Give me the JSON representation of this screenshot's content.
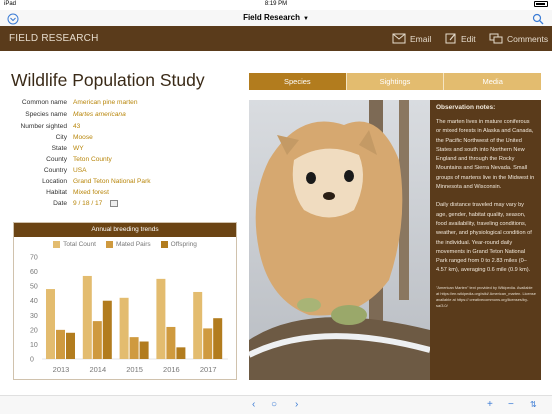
{
  "status_bar": {
    "device": "iPad",
    "time": "8:19 PM",
    "battery_percent": 100,
    "battery_label": ""
  },
  "nav_bar": {
    "title": "Field Research",
    "colors": {
      "tint": "#3a7bd5"
    }
  },
  "toolbar": {
    "brand": "FIELD RESEARCH",
    "email_label": "Email",
    "edit_label": "Edit",
    "comments_label": "Comments",
    "colors": {
      "background": "#5a3b1b",
      "text": "#e6dccd"
    }
  },
  "record": {
    "title": "Wildlife Population Study",
    "fields": [
      {
        "label": "Common name",
        "value": "American pine marten"
      },
      {
        "label": "Species name",
        "value": "Martes americana"
      },
      {
        "label": "Number sighted",
        "value": "43"
      },
      {
        "label": "City",
        "value": "Moose"
      },
      {
        "label": "State",
        "value": "WY"
      },
      {
        "label": "County",
        "value": "Teton County"
      },
      {
        "label": "Country",
        "value": "USA"
      },
      {
        "label": "Location",
        "value": "Grand Teton National Park"
      },
      {
        "label": "Habitat",
        "value": "Mixed forest"
      },
      {
        "label": "Date",
        "value": "9 / 18 / 17"
      }
    ],
    "colors": {
      "value": "#b8860b"
    }
  },
  "tabs": [
    {
      "label": "Species",
      "active": true
    },
    {
      "label": "Sightings",
      "active": false
    },
    {
      "label": "Media",
      "active": false
    }
  ],
  "notes": {
    "heading": "Observation notes:",
    "paragraph1": "The marten lives in mature coniferous or mixed forests in Alaska and Canada, the Pacific Northwest of the United States and south into Northern New England and through the Rocky Mountains and Sierra Nevada. Small groups of martens live in the Midwest in Minnesota and Wisconsin.",
    "paragraph2": "Daily distance traveled may vary by age, gender, habitat quality, season, food availability, traveling conditions, weather, and physiological condition of the individual. Year-round daily movements in Grand Teton National Park ranged from 0 to 2.83 miles (0–4.57 km), averaging 0.6 mile (0.9 km).",
    "credit": "\"American Marten\" text provided by Wikipedia. Available at https://en.wikipedia.org/wiki/ American_marten. License available at https:// creativecommons.org/licenses/by-sa/3.0/"
  },
  "chart_data": {
    "type": "bar",
    "title": "Annual breeding trends",
    "categories": [
      "2013",
      "2014",
      "2015",
      "2016",
      "2017"
    ],
    "series": [
      {
        "name": "Total Count",
        "values": [
          48,
          57,
          42,
          55,
          46
        ],
        "color": "#e3bc6f"
      },
      {
        "name": "Mated Pairs",
        "values": [
          20,
          26,
          15,
          22,
          21
        ],
        "color": "#cf9a3f"
      },
      {
        "name": "Offspring",
        "values": [
          18,
          40,
          12,
          8,
          28
        ],
        "color": "#b27c1e"
      }
    ],
    "ylim": [
      0,
      70
    ],
    "yticks": [
      "0",
      "10",
      "20",
      "30",
      "40",
      "50",
      "60",
      "70"
    ],
    "grid": false,
    "legend": "top-center",
    "xlabel": "",
    "ylabel": ""
  }
}
